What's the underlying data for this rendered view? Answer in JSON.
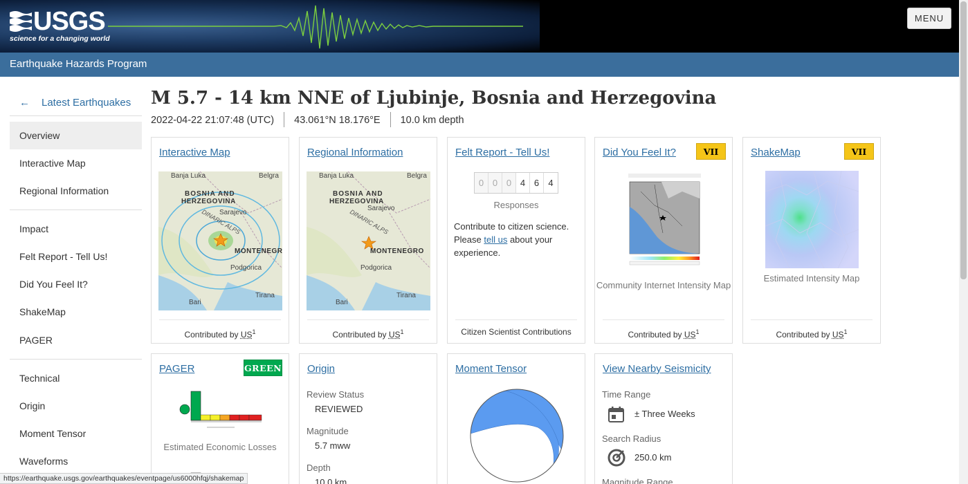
{
  "header": {
    "logo_text": "USGS",
    "logo_tagline": "science for a changing world",
    "menu_label": "MENU",
    "program_title": "Earthquake Hazards Program"
  },
  "sidebar": {
    "back_label": "Latest Earthquakes",
    "back_arrow": "←",
    "items": [
      {
        "label": "Overview",
        "active": true
      },
      {
        "label": "Interactive Map"
      },
      {
        "label": "Regional Information"
      },
      {
        "label": "Impact"
      },
      {
        "label": "Felt Report - Tell Us!"
      },
      {
        "label": "Did You Feel It?"
      },
      {
        "label": "ShakeMap"
      },
      {
        "label": "PAGER"
      },
      {
        "label": "Technical"
      },
      {
        "label": "Origin"
      },
      {
        "label": "Moment Tensor"
      },
      {
        "label": "Waveforms"
      }
    ]
  },
  "event": {
    "title": "M 5.7 - 14 km NNE of Ljubinje, Bosnia and Herzegovina",
    "time": "2022-04-22 21:07:48 (UTC)",
    "location": "43.061°N 18.176°E",
    "depth": "10.0 km depth"
  },
  "map_labels": {
    "belgra": "Belgra",
    "banja_luka": "Banja Luka",
    "bosnia_1": "BOSNIA AND",
    "bosnia_2": "HERZEGOVINA",
    "dinaric": "DINARIC ALPS",
    "sarajevo": "Sarajevo",
    "montenegro": "MONTENEGRO",
    "podgorica": "Podgorica",
    "bari": "Bari",
    "tirana": "Tirana"
  },
  "cards": {
    "interactive_map": {
      "title": "Interactive Map",
      "contributed": "Contributed by",
      "net": "US",
      "sup": "1"
    },
    "regional": {
      "title": "Regional Information",
      "contributed": "Contributed by",
      "net": "US",
      "sup": "1"
    },
    "felt_report": {
      "title": "Felt Report - Tell Us!",
      "digits": [
        "0",
        "0",
        "0",
        "4",
        "6",
        "4"
      ],
      "responses_label": "Responses",
      "text_before": "Contribute to citizen science. Please ",
      "link": "tell us",
      "text_after": " about your experience.",
      "footer": "Citizen Scientist Contributions"
    },
    "dyfi": {
      "title": "Did You Feel It?",
      "badge": "VII",
      "caption": "Community Internet Intensity Map",
      "contributed": "Contributed by",
      "net": "US",
      "sup": "1"
    },
    "shakemap": {
      "title": "ShakeMap",
      "badge": "VII",
      "caption": "Estimated Intensity Map",
      "contributed": "Contributed by",
      "net": "US",
      "sup": "1"
    },
    "pager": {
      "title": "PAGER",
      "badge": "GREEN",
      "caption": "Estimated Economic Losses"
    },
    "origin": {
      "title": "Origin",
      "review_label": "Review Status",
      "review_value": "REVIEWED",
      "magnitude_label": "Magnitude",
      "magnitude_value": "5.7 mww",
      "depth_label": "Depth",
      "depth_value": "10.0 km"
    },
    "moment_tensor": {
      "title": "Moment Tensor"
    },
    "nearby": {
      "title": "View Nearby Seismicity",
      "time_label": "Time Range",
      "time_value": "± Three Weeks",
      "radius_label": "Search Radius",
      "radius_value": "250.0 km",
      "magnitude_label": "Magnitude Range"
    }
  },
  "status_url": "https://earthquake.usgs.gov/earthquakes/eventpage/us6000hfqj/shakemap",
  "colors": {
    "link": "#2d6ea3",
    "program_bar": "#3b6e9c",
    "badge_vii": "#f5c518",
    "badge_green": "#00a84f"
  }
}
